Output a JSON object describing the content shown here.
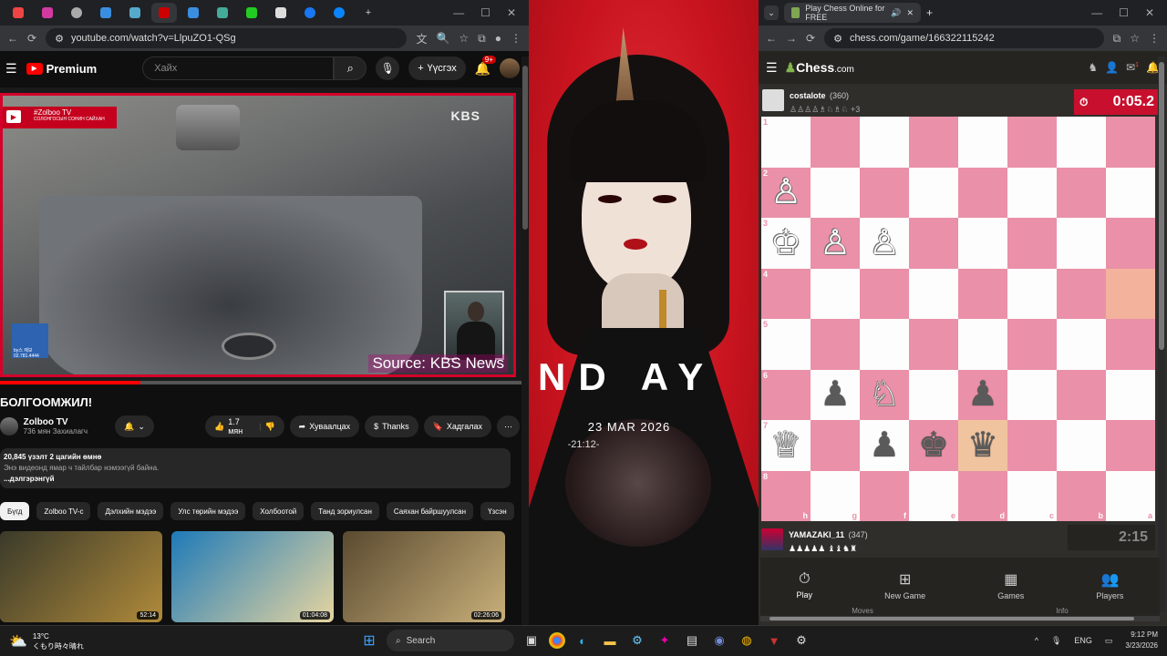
{
  "youtube_window": {
    "url": "youtube.com/watch?v=LlpuZO1-QSg",
    "logo_text": "Premium",
    "search_placeholder": "Хайх",
    "create_label": "Үүсгэх",
    "notif_badge": "9+",
    "video": {
      "channel_tag": "#Zolboo TV",
      "channel_tag_sub": "СОЛОНГОСЫН СОНИН САЙХАН",
      "watermark": "KBS",
      "source_text": "Source: KBS News",
      "side_badge": "by스 제보 02.781.4444",
      "progress_fraction": 0.27
    },
    "title": "БОЛГООМЖИЛ!",
    "channel_name": "Zolboo TV",
    "channel_subs": "736 мян Захиалагч",
    "likes": "1.7 мян",
    "share_label": "Хуваалцах",
    "thanks_label": "Thanks",
    "save_label": "Хадгалах",
    "views_line": "20,845 үзэлт  2 цагийн өмнө",
    "desc_line": "Энэ видеонд ямар ч тайлбар нэмээгүй байна.",
    "more_label": "...дэлгэрэнгүй",
    "chips": [
      "Бүгд",
      "Zolboo TV-с",
      "Дэлхийн мэдээ",
      "Улс төрийн мэдээ",
      "Холбоотой",
      "Танд зориулсан",
      "Саяхан байршуулсан",
      "Үзсэн"
    ],
    "thumbs": [
      {
        "duration": "52:14",
        "colorA": "#3a3a2a",
        "colorB": "#b08a3a"
      },
      {
        "duration": "01:04:08",
        "colorA": "#1e7ab8",
        "colorB": "#e6d5a0"
      },
      {
        "duration": "02:26:06",
        "colorA": "#5a4a30",
        "colorB": "#c9b07a"
      }
    ]
  },
  "wallpaper": {
    "big_text": "ND AY",
    "date": "23 MAR 2026",
    "time": "-21:12-"
  },
  "chess_window": {
    "tab_title": "Play Chess Online for FREE",
    "url": "chess.com/game/166322115242",
    "logo": "Chess",
    "logo_suffix": ".com",
    "notif_badge": "1",
    "top_player": {
      "name": "costalote",
      "rating": "(360)",
      "captured": "♙♙♙♙♗♘♗♘ +3",
      "clock": "0:05.2"
    },
    "bottom_player": {
      "name": "YAMAZAKI_11",
      "rating": "(347)",
      "captured": "♟♟♟♟♟ ♝♝♞♜",
      "clock": "2:15"
    },
    "ranks": [
      "1",
      "2",
      "3",
      "4",
      "5",
      "6",
      "7",
      "8"
    ],
    "files": [
      "h",
      "g",
      "f",
      "e",
      "d",
      "c",
      "b",
      "a"
    ],
    "pieces": [
      {
        "sq": "r2c1",
        "glyph": "♙",
        "side": "w"
      },
      {
        "sq": "r3c1",
        "glyph": "♔",
        "side": "w"
      },
      {
        "sq": "r3c2",
        "glyph": "♙",
        "side": "w"
      },
      {
        "sq": "r3c3",
        "glyph": "♙",
        "side": "w"
      },
      {
        "sq": "r6c2",
        "glyph": "♟",
        "side": "b"
      },
      {
        "sq": "r6c3",
        "glyph": "♘",
        "side": "w"
      },
      {
        "sq": "r6c5",
        "glyph": "♟",
        "side": "b"
      },
      {
        "sq": "r7c1",
        "glyph": "♕",
        "side": "w"
      },
      {
        "sq": "r7c3",
        "glyph": "♟",
        "side": "b"
      },
      {
        "sq": "r7c4",
        "glyph": "♚",
        "side": "b"
      },
      {
        "sq": "r7c5",
        "glyph": "♛",
        "side": "b"
      }
    ],
    "highlights": [
      "r4c8",
      "r7c5"
    ],
    "nav": [
      {
        "label": "Play",
        "icon": "⏱",
        "active": true
      },
      {
        "label": "New Game",
        "icon": "⊞",
        "active": false
      },
      {
        "label": "Games",
        "icon": "▦",
        "active": false
      },
      {
        "label": "Players",
        "icon": "👥",
        "active": false
      }
    ],
    "below_nav": [
      "Moves",
      "Info"
    ]
  },
  "taskbar": {
    "temp": "13°C",
    "weather_desc": "くもり時々晴れ",
    "search_label": "Search",
    "lang": "ENG",
    "time": "9:12 PM",
    "date": "3/23/2026"
  }
}
